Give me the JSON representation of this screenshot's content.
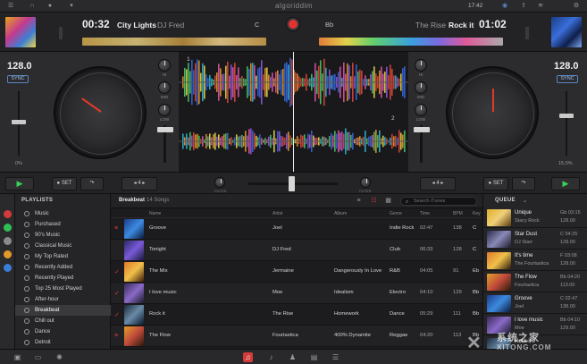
{
  "statusbar": {
    "app_logo": "algoriddim",
    "clock": "17:42",
    "icons": [
      "sliders-icon",
      "headphones-icon",
      "mic-icon",
      "wifi-icon",
      "share-icon",
      "gear-icon"
    ]
  },
  "deck_left": {
    "time": "00:32",
    "title": "City Lights",
    "artist": "DJ Fred",
    "key": "C",
    "bpm": "128.0",
    "sync_label": "SYNC",
    "pitch_pct": "0%",
    "set_label": "SET",
    "loop_value": "4",
    "filter_label": "FILTER"
  },
  "deck_right": {
    "time": "01:02",
    "title": "Rock it",
    "artist": "The Rise",
    "key": "Bb",
    "bpm": "128.0",
    "sync_label": "SYNC",
    "pitch_pct": "15.0%",
    "set_label": "SET",
    "loop_value": "4",
    "filter_label": "FILTER"
  },
  "eq_labels": {
    "hi": "HI",
    "mid": "MID",
    "low": "LOW"
  },
  "wave": {
    "deck1_num": "1",
    "deck2_num": "2"
  },
  "colors": {
    "accent_red": "#e23232",
    "sync_blue": "#5a86c2",
    "play_green": "#39d15a"
  },
  "playlists": {
    "header": "PLAYLISTS",
    "items": [
      "Music",
      "Purchased",
      "90's Music",
      "Classical Music",
      "My Top Rated",
      "Recently Added",
      "Recently Played",
      "Top 25 Most Played",
      "After-hour",
      "Breakbeat",
      "Chill out",
      "Dance",
      "Detroit"
    ]
  },
  "tracklist": {
    "title": "Breakbeat",
    "count": "14 Songs",
    "search_placeholder": "Search iTunes",
    "columns": {
      "name": "Name",
      "artist": "Artist",
      "album": "Album",
      "genre": "Genre",
      "time": "Time",
      "bpm": "BPM",
      "key": "Key"
    },
    "rows": [
      {
        "name": "Groove",
        "artist": "Joel",
        "album": "",
        "genre": "Indie Rock",
        "time": "02:47",
        "bpm": "138",
        "key": "C"
      },
      {
        "name": "Tonight",
        "artist": "DJ Fred",
        "album": "",
        "genre": "Club",
        "time": "06:33",
        "bpm": "128",
        "key": "C"
      },
      {
        "name": "The Mix",
        "artist": "Jermaine",
        "album": "Dangerously In Love",
        "genre": "R&B",
        "time": "04:05",
        "bpm": "91",
        "key": "Eb"
      },
      {
        "name": "I love music",
        "artist": "Moe",
        "album": "Idealism",
        "genre": "Electro",
        "time": "04:10",
        "bpm": "129",
        "key": "Bb"
      },
      {
        "name": "Rock it",
        "artist": "The Rise",
        "album": "Homework",
        "genre": "Dance",
        "time": "05:29",
        "bpm": "111",
        "key": "Bb"
      },
      {
        "name": "The Flow",
        "artist": "Fourtastica",
        "album": "400% Dynamite",
        "genre": "Reggae",
        "time": "04:20",
        "bpm": "113",
        "key": "Bb"
      }
    ]
  },
  "queue": {
    "header": "QUEUE",
    "items": [
      {
        "title": "Unique",
        "artist": "Stacy Rock",
        "key": "Gb 03:15",
        "bpm": "128.00"
      },
      {
        "title": "Star Dust",
        "artist": "DJ Starr",
        "key": "C 04:25",
        "bpm": "128.00"
      },
      {
        "title": "It's time",
        "artist": "The Fourtastica",
        "key": "F 03:08",
        "bpm": "128.00"
      },
      {
        "title": "The Flow",
        "artist": "Fourtastica",
        "key": "Bb 04:20",
        "bpm": "113.00"
      },
      {
        "title": "Groove",
        "artist": "Joel",
        "key": "C 02:47",
        "bpm": "138.00"
      },
      {
        "title": "I love music",
        "artist": "Moe",
        "key": "Bb 04:10",
        "bpm": "129.00"
      },
      {
        "title": "Rock it",
        "artist": "",
        "key": "",
        "bpm": ""
      }
    ]
  }
}
